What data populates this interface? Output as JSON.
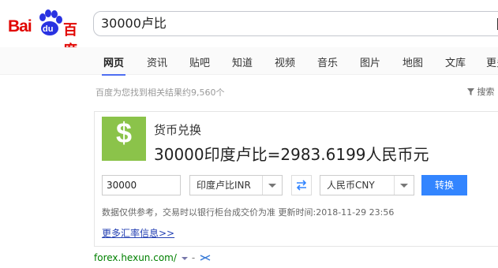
{
  "brand": {
    "logo_bai": "Bai",
    "logo_du": "du",
    "logo_cn": "百度",
    "color": "#e10602"
  },
  "search": {
    "query": "30000卢比"
  },
  "tabs": [
    {
      "label": "网页",
      "active": true
    },
    {
      "label": "资讯"
    },
    {
      "label": "贴吧"
    },
    {
      "label": "知道"
    },
    {
      "label": "视频"
    },
    {
      "label": "音乐"
    },
    {
      "label": "图片"
    },
    {
      "label": "地图"
    },
    {
      "label": "文库"
    },
    {
      "label": "更多"
    }
  ],
  "results": {
    "count_text": "百度为您找到相关结果约9,560个",
    "tools_label": "搜索"
  },
  "card": {
    "icon": "dollar-icon",
    "title": "货币兑换",
    "result": "30000印度卢比=2983.6199人民币元",
    "amount": "30000",
    "from_currency": "印度卢比INR",
    "to_currency": "人民币CNY",
    "convert_label": "转换",
    "note": "数据仅供参考，交易时以银行柜台成交价为准 更新时间:2018-11-29 23:56",
    "more_link": "更多汇率信息>>",
    "accent": "#3385ff",
    "icon_bg": "#8bc34a"
  },
  "source": {
    "url": "forex.hexun.com/",
    "sep": "-"
  }
}
